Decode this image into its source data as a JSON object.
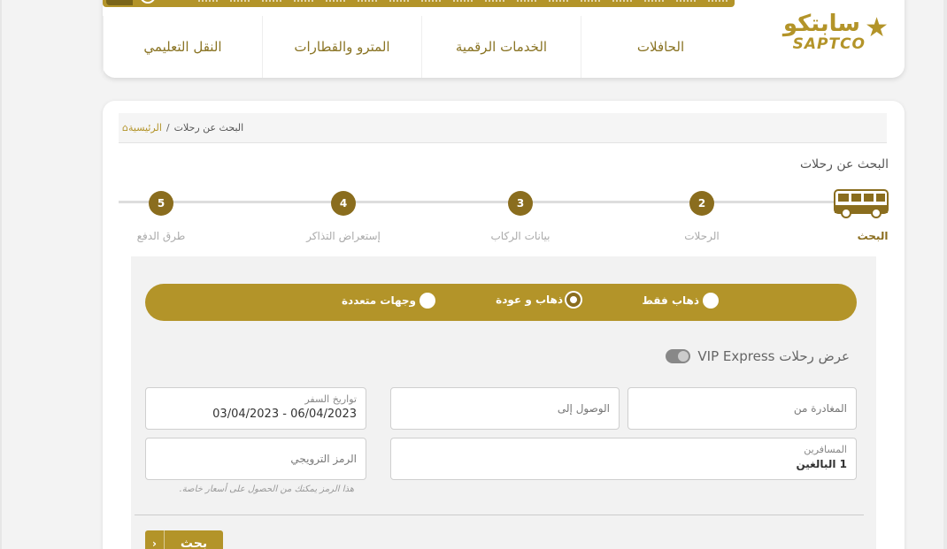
{
  "nav": {
    "items": [
      {
        "label": "الحافلات"
      },
      {
        "label": "الخدمات الرقمية"
      },
      {
        "label": "المترو والقطارات"
      },
      {
        "label": "النقل التعليمي"
      }
    ],
    "logo_ar": "سابتكو",
    "logo_en": "SAPTCO"
  },
  "breadcrumb": {
    "home": "الرئيسية",
    "separator": "/",
    "current": "البحث عن رحلات"
  },
  "page_title": "البحث عن رحلات",
  "stepper": {
    "steps": [
      {
        "number": "",
        "label": "البحث",
        "active": true
      },
      {
        "number": "2",
        "label": "الرحلات"
      },
      {
        "number": "3",
        "label": "بيانات الركاب"
      },
      {
        "number": "4",
        "label": "إستعراض التذاكر"
      },
      {
        "number": "5",
        "label": "طرق الدفع"
      }
    ]
  },
  "trip_type": {
    "options": [
      {
        "label": "ذهاب فقط",
        "checked": false
      },
      {
        "label": "ذهاب و عودة",
        "checked": true
      },
      {
        "label": "وجهات متعددة",
        "checked": false
      }
    ]
  },
  "vip": {
    "label": "عرض رحلات VIP Express",
    "enabled": false
  },
  "form": {
    "departure_placeholder": "المغادرة من",
    "arrival_placeholder": "الوصول إلى",
    "dates_label": "تواريخ السفر",
    "dates_value": "06/04/2023 - 03/04/2023",
    "passengers_label": "المسافرين",
    "passengers_value": "1 البالغين",
    "promo_placeholder": "الرمز الترويجي",
    "promo_hint": "هذا الرمز يمكنك من الحصول على أسعار خاصة."
  },
  "search_button": "بحث",
  "colors": {
    "gold": "#b39429",
    "dark_gold": "#8a6d1e"
  }
}
